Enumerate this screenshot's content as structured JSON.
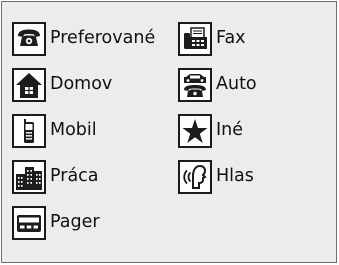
{
  "phone_types": [
    {
      "label": "Preferované",
      "icon": "telephone-icon"
    },
    {
      "label": "Fax",
      "icon": "fax-icon"
    },
    {
      "label": "Domov",
      "icon": "house-icon"
    },
    {
      "label": "Auto",
      "icon": "car-phone-icon"
    },
    {
      "label": "Mobil",
      "icon": "mobile-phone-icon"
    },
    {
      "label": "Iné",
      "icon": "star-icon"
    },
    {
      "label": "Práca",
      "icon": "office-building-icon"
    },
    {
      "label": "Hlas",
      "icon": "voice-icon"
    },
    {
      "label": "Pager",
      "icon": "pager-icon"
    }
  ],
  "colors": {
    "panel_background": "#ececec",
    "panel_border": "#6e6e6e",
    "icon_fill": "#1c1c1c",
    "icon_background": "#fdfdfd",
    "label_text": "#111111"
  }
}
